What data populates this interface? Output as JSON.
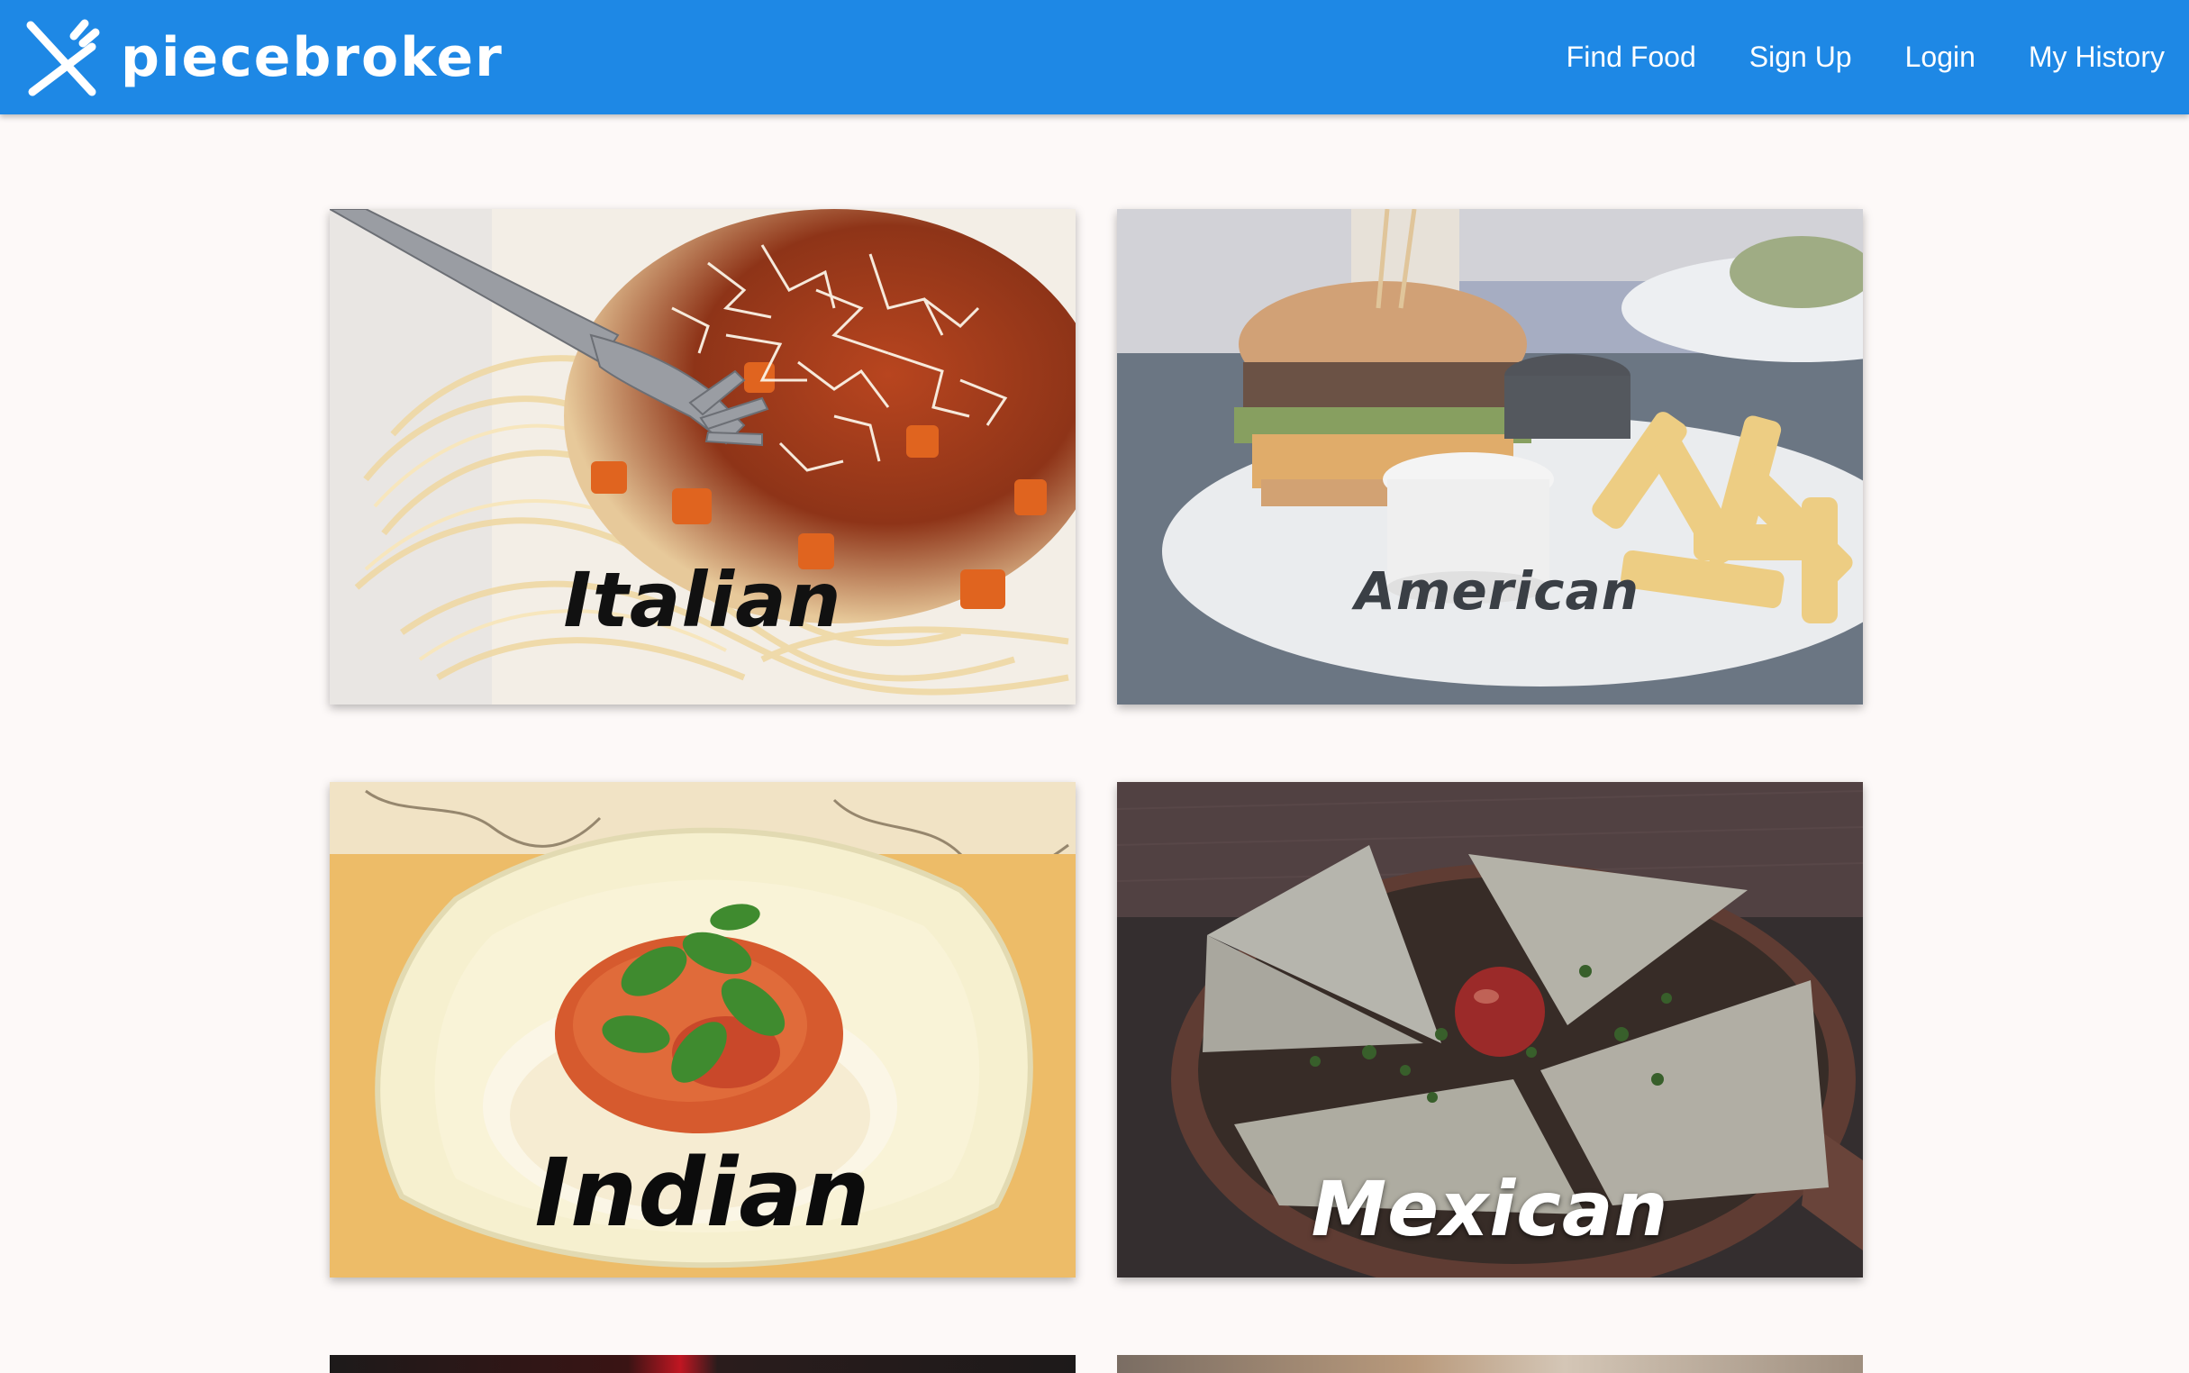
{
  "brand": {
    "name": "piecebroker",
    "logo_icon": "fork-knife-logo-icon"
  },
  "nav": {
    "items": [
      {
        "label": "Find Food"
      },
      {
        "label": "Sign Up"
      },
      {
        "label": "Login"
      },
      {
        "label": "My History"
      }
    ]
  },
  "colors": {
    "navbar": "#1e88e5",
    "page_background": "#fdf9f8",
    "nav_text": "#ffffff"
  },
  "cuisines": [
    {
      "label": "Italian",
      "label_color": "#111111"
    },
    {
      "label": "American",
      "label_color": "#3a3f45"
    },
    {
      "label": "Indian",
      "label_color": "#0c0c0c"
    },
    {
      "label": "Mexican",
      "label_color": "#ffffff"
    }
  ]
}
